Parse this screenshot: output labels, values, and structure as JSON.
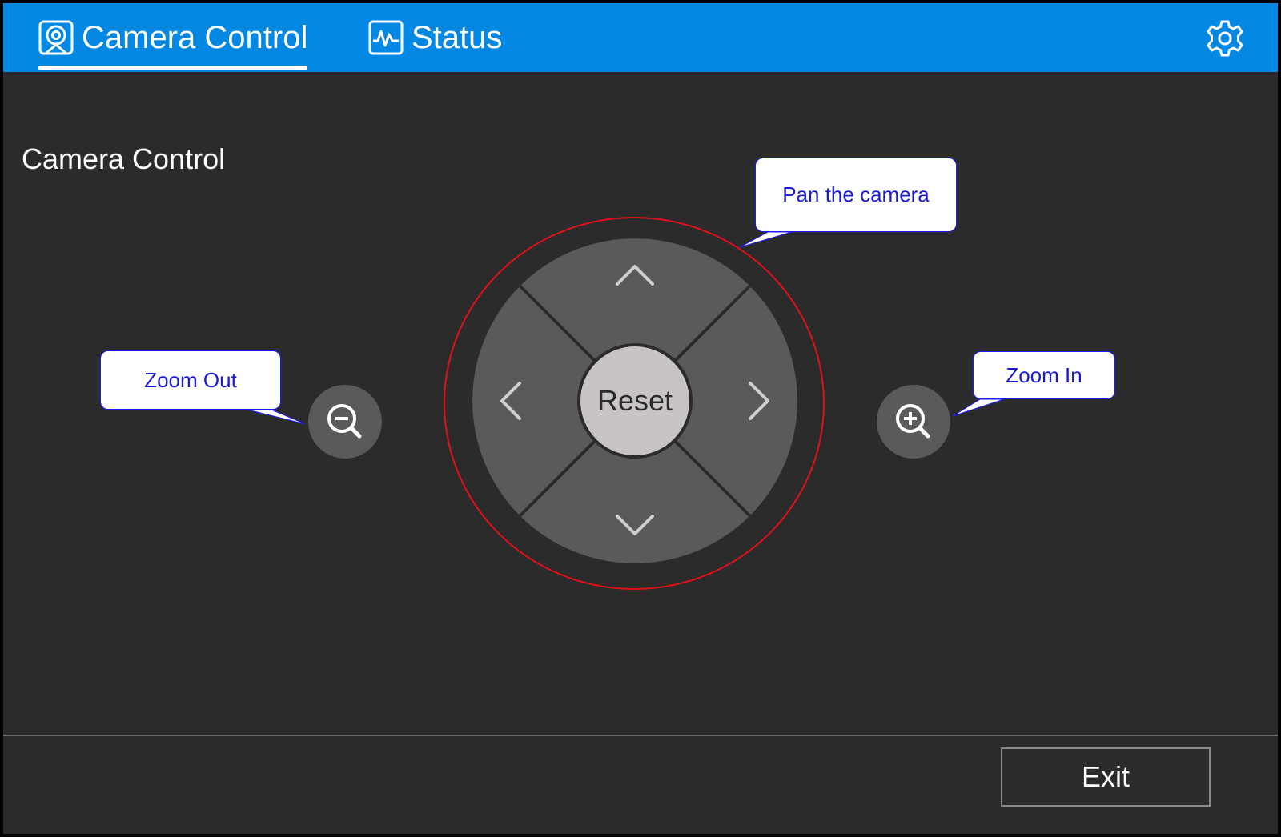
{
  "header": {
    "tabs": [
      {
        "label": "Camera Control",
        "icon": "camera-icon",
        "active": true
      },
      {
        "label": "Status",
        "icon": "activity-icon",
        "active": false
      }
    ],
    "settings_icon": "gear-icon",
    "bar_color": "#0288e2"
  },
  "main": {
    "section_title": "Camera Control",
    "dpad": {
      "up_icon": "chevron-up-icon",
      "down_icon": "chevron-down-icon",
      "left_icon": "chevron-left-icon",
      "right_icon": "chevron-right-icon",
      "reset_label": "Reset"
    },
    "zoom_out_icon": "zoom-out-icon",
    "zoom_in_icon": "zoom-in-icon",
    "callouts": {
      "pan": "Pan the camera",
      "zoom_out": "Zoom Out",
      "zoom_in": "Zoom In"
    },
    "highlight_color": "#e0101a"
  },
  "footer": {
    "exit_label": "Exit"
  }
}
